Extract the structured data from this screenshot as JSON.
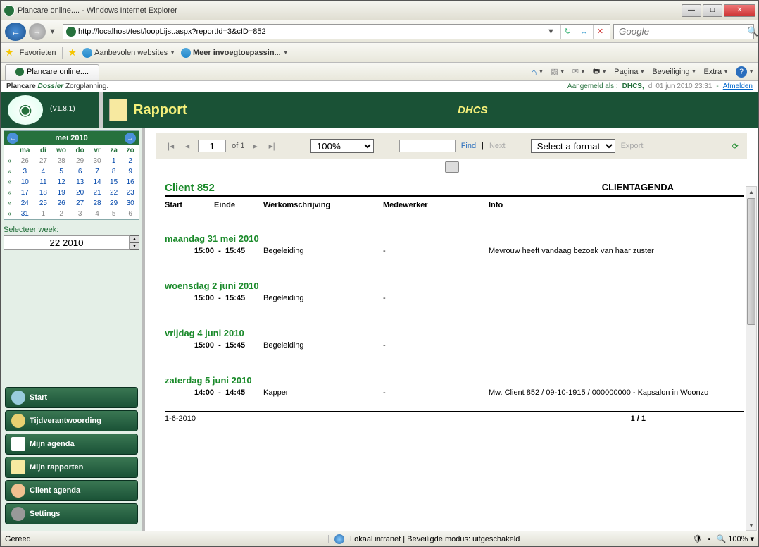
{
  "window": {
    "title": "Plancare online.... - Windows Internet Explorer"
  },
  "nav": {
    "url": "http://localhost/test/loopLijst.aspx?reportId=3&cID=852",
    "search_placeholder": "Google"
  },
  "favbar": {
    "favorites": "Favorieten",
    "suggested": "Aanbevolen websites",
    "more": "Meer invoegtoepassin..."
  },
  "tabbar": {
    "tab": "Plancare online....",
    "page": "Pagina",
    "security": "Beveiliging",
    "extra": "Extra"
  },
  "app_header": {
    "brand1": "Plancare",
    "brand2": "Dossier",
    "brand3": "Zorgplanning.",
    "logged_as": "Aangemeld als :",
    "user": "DHCS,",
    "date": "di 01 jun 2010 23:31",
    "sep": "-",
    "logout": "Afmelden"
  },
  "banner": {
    "version": "(V1.8.1)",
    "title": "Rapport",
    "center": "DHCS"
  },
  "calendar": {
    "month": "mei 2010",
    "dow": [
      "ma",
      "di",
      "wo",
      "do",
      "vr",
      "za",
      "zo"
    ],
    "rows": [
      [
        "26",
        "27",
        "28",
        "29",
        "30",
        "1",
        "2"
      ],
      [
        "3",
        "4",
        "5",
        "6",
        "7",
        "8",
        "9"
      ],
      [
        "10",
        "11",
        "12",
        "13",
        "14",
        "15",
        "16"
      ],
      [
        "17",
        "18",
        "19",
        "20",
        "21",
        "22",
        "23"
      ],
      [
        "24",
        "25",
        "26",
        "27",
        "28",
        "29",
        "30"
      ],
      [
        "31",
        "1",
        "2",
        "3",
        "4",
        "5",
        "6"
      ]
    ],
    "week_label": "Selecteer week:",
    "week_value": "22 2010"
  },
  "sidebar_buttons": {
    "start": "Start",
    "timer": "Tijdverantwoording",
    "agenda": "Mijn agenda",
    "report": "Mijn rapporten",
    "client": "Client agenda",
    "settings": "Settings"
  },
  "toolbar": {
    "page_current": "1",
    "page_of": "of 1",
    "zoom": "100%",
    "find": "Find",
    "sep": "|",
    "next": "Next",
    "format": "Select a format",
    "export": "Export"
  },
  "report": {
    "client_title": "Client 852",
    "agenda_title": "CLIENTAGENDA",
    "cols": {
      "start": "Start",
      "end": "Einde",
      "desc": "Werkomschrijving",
      "med": "Medewerker",
      "info": "Info"
    },
    "days": [
      {
        "head": "maandag 31 mei 2010",
        "start": "15:00",
        "end": "15:45",
        "desc": "Begeleiding",
        "med": "-",
        "info": "Mevrouw heeft vandaag bezoek van haar zuster"
      },
      {
        "head": "woensdag 2 juni 2010",
        "start": "15:00",
        "end": "15:45",
        "desc": "Begeleiding",
        "med": "-",
        "info": ""
      },
      {
        "head": "vrijdag 4 juni 2010",
        "start": "15:00",
        "end": "15:45",
        "desc": "Begeleiding",
        "med": "-",
        "info": ""
      },
      {
        "head": "zaterdag 5 juni 2010",
        "start": "14:00",
        "end": "14:45",
        "desc": "Kapper",
        "med": "-",
        "info": "Mw. Client 852 / 09-10-1915 / 000000000 - Kapsalon in Woonzo"
      }
    ],
    "footer_date": "1-6-2010",
    "footer_page": "1 / 1"
  },
  "statusbar": {
    "ready": "Gereed",
    "zone": "Lokaal intranet | Beveiligde modus: uitgeschakeld",
    "zoom": "100%"
  }
}
